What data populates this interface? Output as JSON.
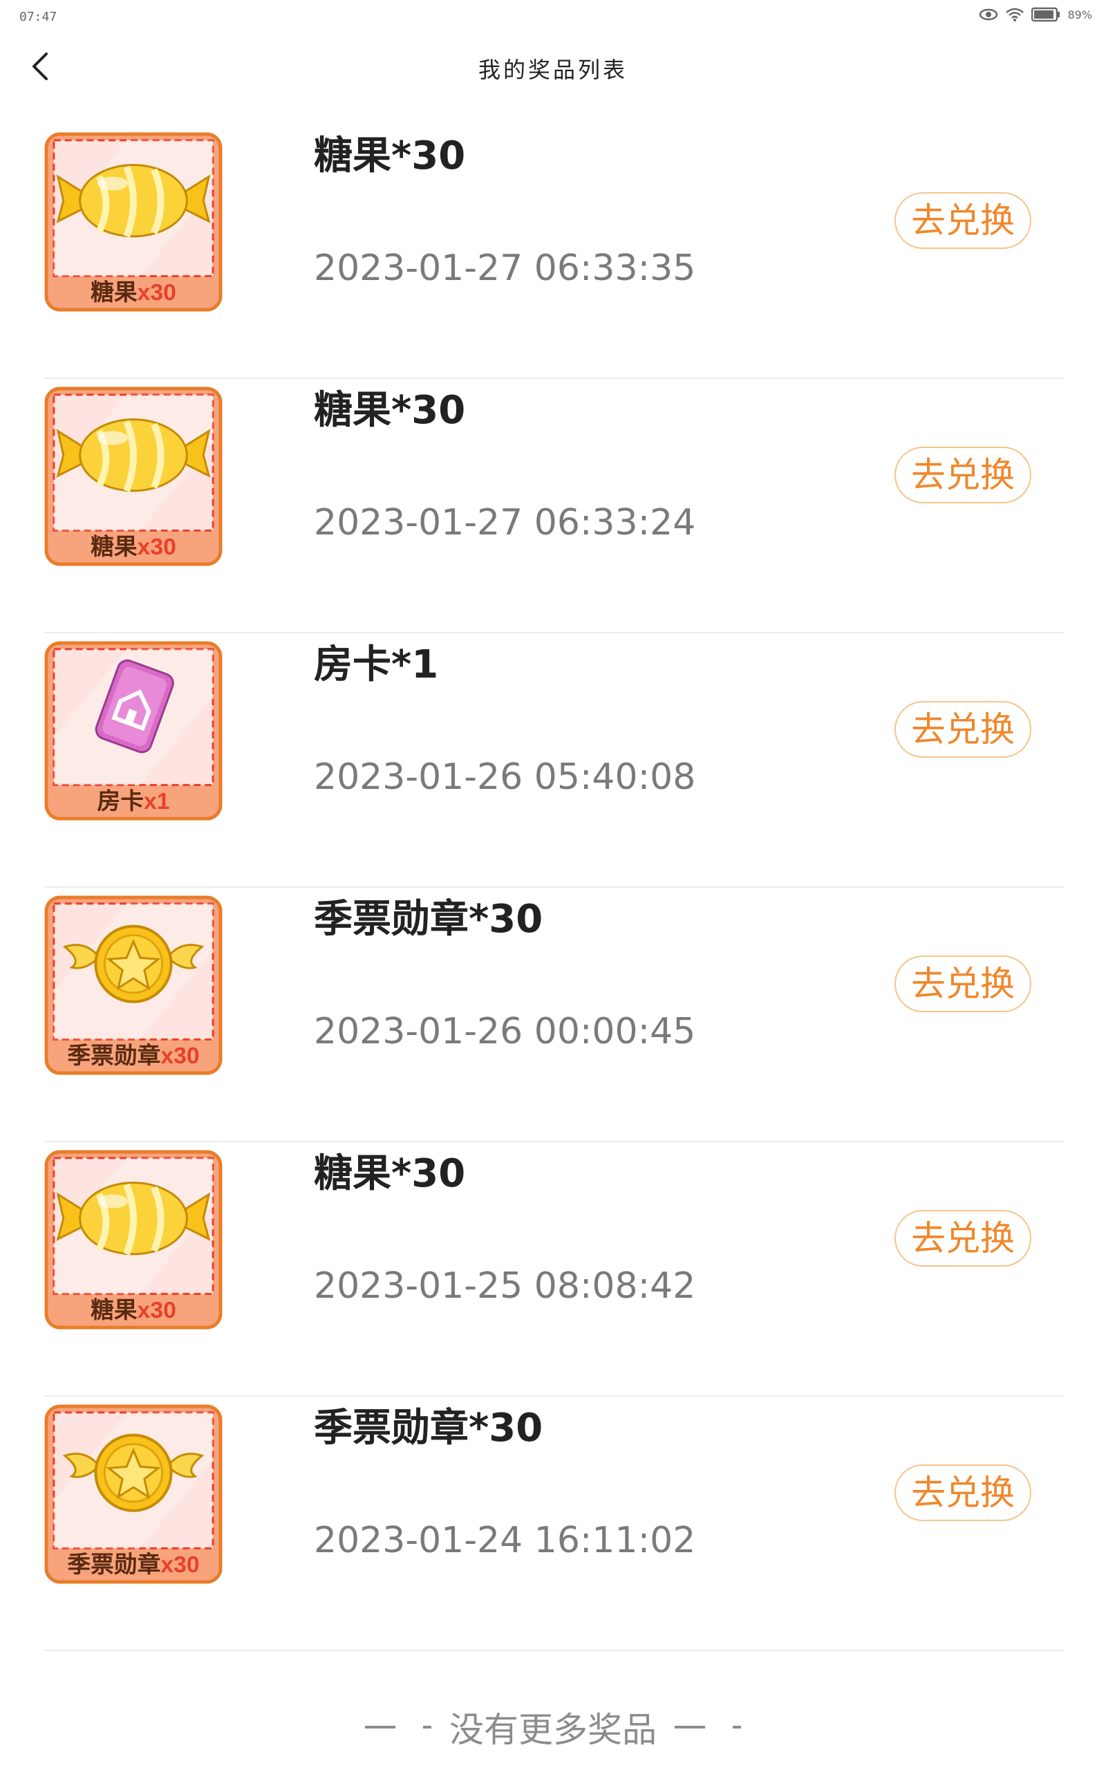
{
  "status_bar": {
    "time": "07:47",
    "battery": "89%"
  },
  "header": {
    "title": "我的奖品列表"
  },
  "prizes": [
    {
      "title": "糖果*30",
      "time": "2023-01-27 06:33:35",
      "button": "去兑换",
      "badge_name": "糖果",
      "badge_qty": "x30",
      "icon": "candy-icon"
    },
    {
      "title": "糖果*30",
      "time": "2023-01-27 06:33:24",
      "button": "去兑换",
      "badge_name": "糖果",
      "badge_qty": "x30",
      "icon": "candy-icon"
    },
    {
      "title": "房卡*1",
      "time": "2023-01-26 05:40:08",
      "button": "去兑换",
      "badge_name": "房卡",
      "badge_qty": "x1",
      "icon": "room-card-icon"
    },
    {
      "title": "季票勋章*30",
      "time": "2023-01-26 00:00:45",
      "button": "去兑换",
      "badge_name": "季票勋章",
      "badge_qty": "x30",
      "icon": "medal-icon"
    },
    {
      "title": "糖果*30",
      "time": "2023-01-25 08:08:42",
      "button": "去兑换",
      "badge_name": "糖果",
      "badge_qty": "x30",
      "icon": "candy-icon"
    },
    {
      "title": "季票勋章*30",
      "time": "2023-01-24 16:11:02",
      "button": "去兑换",
      "badge_name": "季票勋章",
      "badge_qty": "x30",
      "icon": "medal-icon"
    }
  ],
  "footer": {
    "text": "没有更多奖品"
  },
  "colors": {
    "accent": "#f0872a",
    "button_border": "#f5c48a",
    "badge_red": "#e8402c",
    "badge_bg": "#f7a47d"
  }
}
